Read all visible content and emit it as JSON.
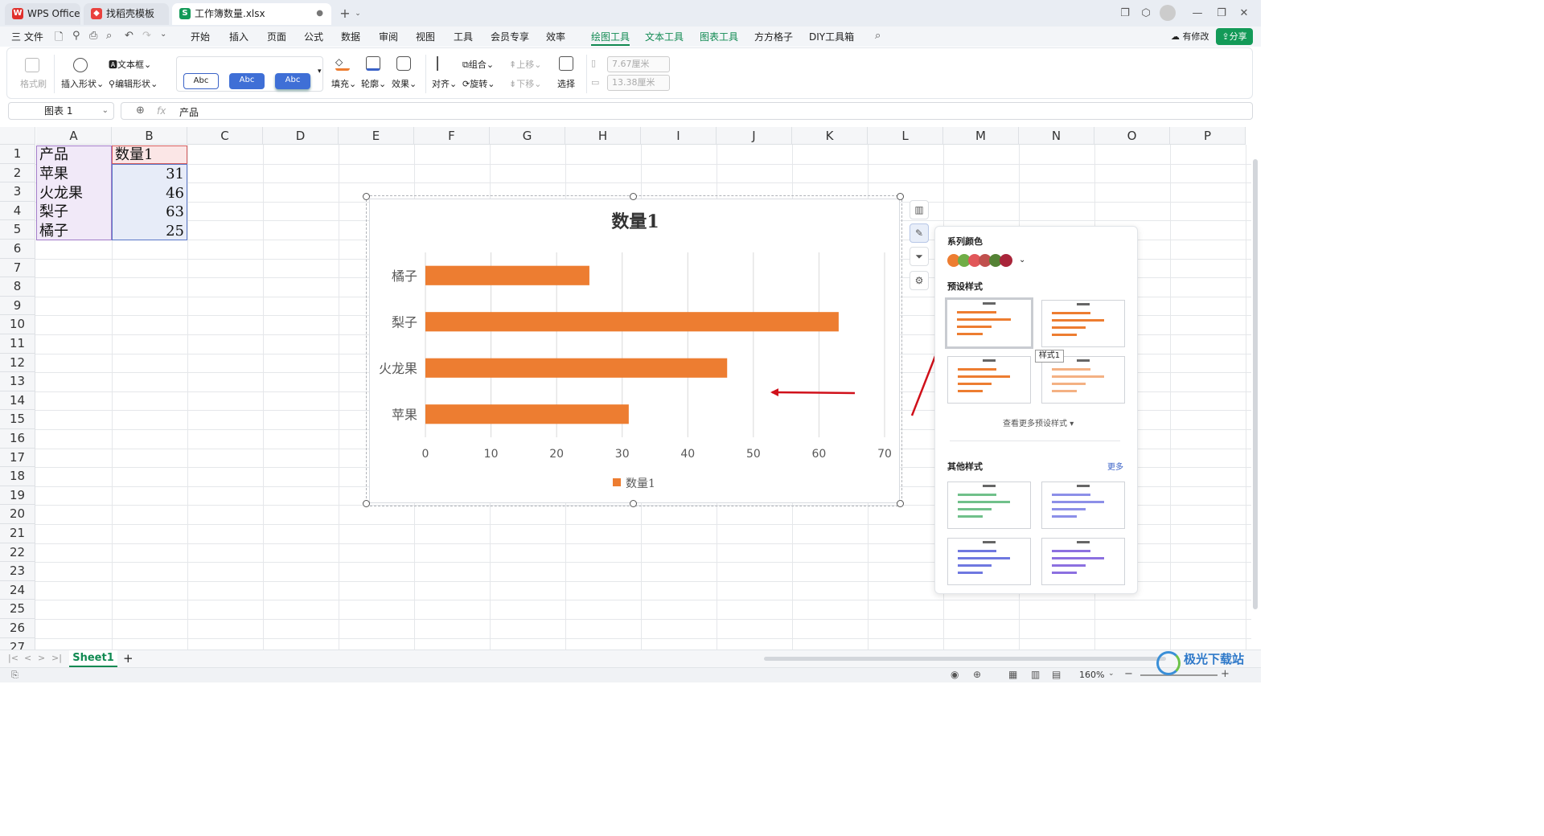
{
  "titlebar": {
    "tabs": [
      {
        "label": "WPS Office",
        "icon": "wps-logo-icon"
      },
      {
        "label": "找稻壳模板",
        "icon": "docer-icon"
      },
      {
        "label": "工作簿数量.xlsx",
        "icon": "spreadsheet-s-icon"
      }
    ],
    "new_tab": "+",
    "s_badge": "S"
  },
  "menubar": {
    "file": "三 文件",
    "items": [
      "开始",
      "插入",
      "页面",
      "公式",
      "数据",
      "审阅",
      "视图",
      "工具",
      "会员专享",
      "效率",
      "绘图工具",
      "文本工具",
      "图表工具",
      "方方格子",
      "DIY工具箱"
    ],
    "modified": "有修改",
    "share": "分享"
  },
  "ribbon": {
    "format_painter": "格式刷",
    "insert_shape": "插入形状",
    "text_box": "文本框",
    "edit_shape": "编辑形状",
    "abc": "Abc",
    "fill": "填充",
    "outline": "轮廓",
    "effect": "效果",
    "align": "对齐",
    "group": "组合",
    "rotate": "旋转",
    "bring_up": "上移",
    "send_down": "下移",
    "select": "选择",
    "height": "7.67厘米",
    "width": "13.38厘米"
  },
  "formula_bar": {
    "name_box": "图表 1",
    "fx": "fx",
    "content": "产品"
  },
  "grid": {
    "columns": [
      "A",
      "B",
      "C",
      "D",
      "E",
      "F",
      "G",
      "H",
      "I",
      "J",
      "K",
      "L",
      "M",
      "N",
      "O",
      "P"
    ],
    "rows": [
      "1",
      "2",
      "3",
      "4",
      "5",
      "6",
      "7",
      "8",
      "9",
      "10",
      "11",
      "12",
      "13",
      "14",
      "15",
      "16",
      "17",
      "18",
      "19",
      "20",
      "21",
      "22",
      "23",
      "24",
      "25",
      "26",
      "27"
    ],
    "table": {
      "header": [
        "产品",
        "数量1"
      ],
      "rows": [
        [
          "苹果",
          "31"
        ],
        [
          "火龙果",
          "46"
        ],
        [
          "梨子",
          "63"
        ],
        [
          "橘子",
          "25"
        ]
      ]
    }
  },
  "chart_data": {
    "type": "bar",
    "orientation": "horizontal",
    "title": "数量1",
    "categories": [
      "苹果",
      "火龙果",
      "梨子",
      "橘子"
    ],
    "series": [
      {
        "name": "数量1",
        "values": [
          31,
          46,
          63,
          25
        ],
        "color": "#ED7D31"
      }
    ],
    "xlim": [
      0,
      70
    ],
    "xticks": [
      0,
      10,
      20,
      30,
      40,
      50,
      60,
      70
    ],
    "grid": true,
    "legend": "bottom"
  },
  "style_panel": {
    "series_color": "系列颜色",
    "colors": [
      "#ED7D31",
      "#70AD47",
      "#E15759",
      "#C0504D",
      "#548235",
      "#A9253A"
    ],
    "preset_styles": "预设样式",
    "tooltip": "样式1",
    "more_presets": "查看更多预设样式",
    "other_styles": "其他样式",
    "more": "更多"
  },
  "sheetbar": {
    "sheet": "Sheet1",
    "add": "+"
  },
  "statusbar": {
    "zoom": "160%"
  },
  "watermark": "极光下载站",
  "colors": {
    "accent": "#118a52",
    "bar": "#ED7D31",
    "arrow": "#d0101a"
  }
}
